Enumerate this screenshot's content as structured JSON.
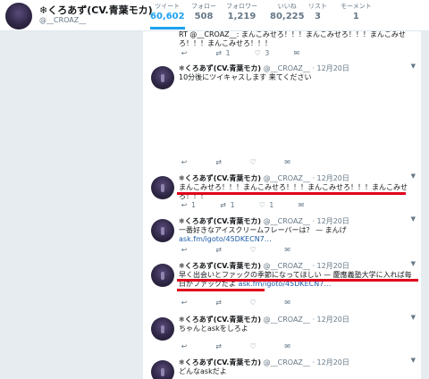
{
  "profile": {
    "name": "❄くろあず(CV.青葉モカ)",
    "handle": "@__CROAZ__"
  },
  "stats": [
    {
      "label": "ツイート",
      "value": "60,602"
    },
    {
      "label": "フォロー",
      "value": "508"
    },
    {
      "label": "フォロワー",
      "value": "1,219"
    },
    {
      "label": "いいね",
      "value": "80,225"
    },
    {
      "label": "リスト",
      "value": "3"
    },
    {
      "label": "モーメント",
      "value": "1"
    }
  ],
  "tweets": [
    {
      "text": "RT @__CROAZ__: まんこみせろ！！！まんこみせろ！！！まんこみせろ！！！まんこみせろ！！！",
      "actions": {
        "reply": "",
        "retweet": "1",
        "like": "3"
      }
    },
    {
      "name": "❄くろあず(CV.青葉モカ)",
      "handle": "@__CROAZ__",
      "time": "· 12月20日",
      "text": "10分後にツイキャスします 来てください",
      "actions": {
        "reply": "",
        "retweet": "",
        "like": ""
      }
    },
    {
      "name": "❄くろあず(CV.青葉モカ)",
      "handle": "@__CROAZ__",
      "time": "· 12月20日",
      "text": "まんこみせろ！！！まんこみせろ！！！まんこみせろ！！！まんこみせろ！！！",
      "actions": {
        "reply": "1",
        "retweet": "1",
        "like": "1"
      }
    },
    {
      "name": "❄くろあず(CV.青葉モカ)",
      "handle": "@__CROAZ__",
      "time": "· 12月20日",
      "text": "一番好きなアイスクリームフレーバーは？ — まんげ ",
      "link": "ask.fm/igoto/45DKECN7…",
      "actions": {
        "reply": "",
        "retweet": "",
        "like": ""
      }
    },
    {
      "name": "❄くろあず(CV.青葉モカ)",
      "handle": "@__CROAZ__",
      "time": "· 12月20日",
      "text": "早く出会いとファックの季節になってほしい — 慶應義塾大学に入れば毎日がファックだよ ",
      "link": "ask.fm/igoto/45DKECN7…",
      "actions": {
        "reply": "",
        "retweet": "",
        "like": ""
      }
    },
    {
      "name": "❄くろあず(CV.青葉モカ)",
      "handle": "@__CROAZ__",
      "time": "· 12月20日",
      "text": "ちゃんとaskをしろよ",
      "actions": {
        "reply": "",
        "retweet": "",
        "like": ""
      }
    },
    {
      "name": "❄くろあず(CV.青葉モカ)",
      "handle": "@__CROAZ__",
      "time": "· 12月20日",
      "text": "どんなaskだよ"
    }
  ],
  "icons": {
    "reply": "reply-icon",
    "retweet": "retweet-icon",
    "like": "heart-icon",
    "message": "envelope-icon",
    "caret": "chevron-down-icon"
  },
  "colors": {
    "accent": "#1da1f2",
    "annotation": "#e0001a",
    "link": "#1b5aa8"
  }
}
